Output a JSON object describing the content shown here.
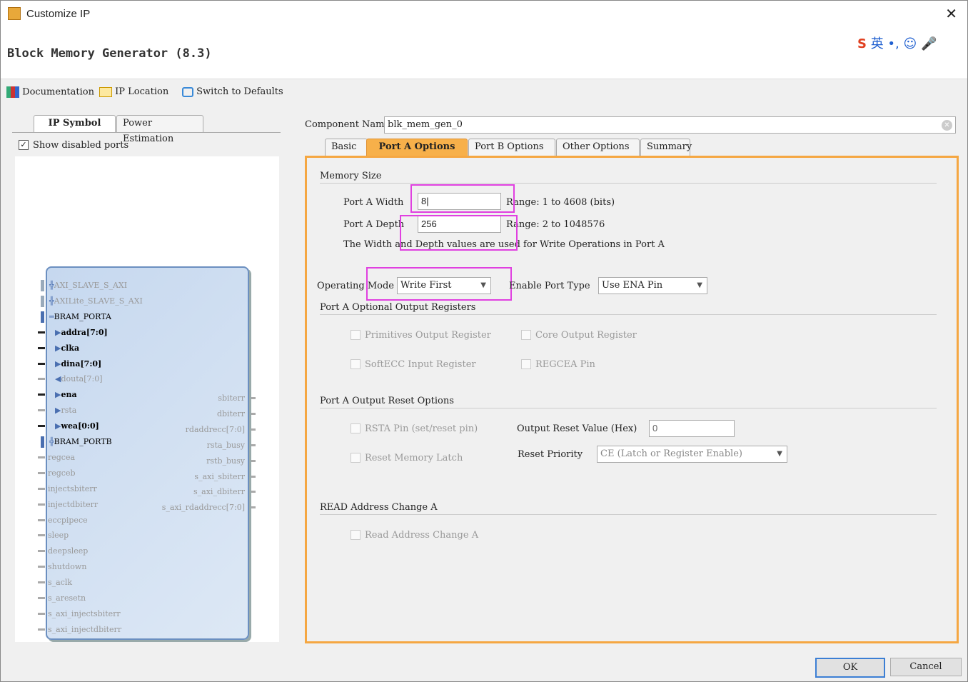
{
  "window": {
    "title": "Customize IP",
    "close_icon": "close-icon"
  },
  "header": {
    "title": "Block Memory Generator (8.3)"
  },
  "toolbar": {
    "documentation": "Documentation",
    "ip_location": "IP Location",
    "switch_defaults": "Switch to Defaults"
  },
  "left": {
    "tabs": [
      "IP Symbol",
      "Power Estimation"
    ],
    "show_disabled": "Show disabled ports",
    "show_disabled_checked": true,
    "left_ports": [
      {
        "name": "AXI_SLAVE_S_AXI",
        "enabled": false,
        "bus": true
      },
      {
        "name": "AXILite_SLAVE_S_AXI",
        "enabled": false,
        "bus": true
      },
      {
        "name": "BRAM_PORTA",
        "enabled": true,
        "bus": true
      },
      {
        "name": "addra[7:0]",
        "enabled": true
      },
      {
        "name": "clka",
        "enabled": true
      },
      {
        "name": "dina[7:0]",
        "enabled": true
      },
      {
        "name": "douta[7:0]",
        "enabled": false
      },
      {
        "name": "ena",
        "enabled": true
      },
      {
        "name": "rsta",
        "enabled": false
      },
      {
        "name": "wea[0:0]",
        "enabled": true
      },
      {
        "name": "BRAM_PORTB",
        "enabled": true,
        "bus": true
      },
      {
        "name": "regcea",
        "enabled": false
      },
      {
        "name": "regceb",
        "enabled": false
      },
      {
        "name": "injectsbiterr",
        "enabled": false
      },
      {
        "name": "injectdbiterr",
        "enabled": false
      },
      {
        "name": "eccpipece",
        "enabled": false
      },
      {
        "name": "sleep",
        "enabled": false
      },
      {
        "name": "deepsleep",
        "enabled": false
      },
      {
        "name": "shutdown",
        "enabled": false
      },
      {
        "name": "s_aclk",
        "enabled": false
      },
      {
        "name": "s_aresetn",
        "enabled": false
      },
      {
        "name": "s_axi_injectsbiterr",
        "enabled": false
      },
      {
        "name": "s_axi_injectdbiterr",
        "enabled": false
      }
    ],
    "right_ports": [
      "sbiterr",
      "dbiterr",
      "rdaddrecc[7:0]",
      "rsta_busy",
      "rstb_busy",
      "s_axi_sbiterr",
      "s_axi_dbiterr",
      "s_axi_rdaddrecc[7:0]"
    ]
  },
  "main": {
    "component_name_label": "Component Name",
    "component_name": "blk_mem_gen_0",
    "tabs": [
      "Basic",
      "Port A Options",
      "Port B Options",
      "Other Options",
      "Summary"
    ],
    "active_tab": "Port A Options",
    "memory_size": {
      "title": "Memory Size",
      "width_label": "Port A Width",
      "width": "8",
      "width_range": "Range: 1 to 4608 (bits)",
      "depth_label": "Port A Depth",
      "depth": "256",
      "depth_range": "Range: 2 to 1048576",
      "note": "The Width and Depth values are used for Write Operations in Port A"
    },
    "operating_mode_label": "Operating Mode",
    "operating_mode": "Write First",
    "enable_port_type_label": "Enable Port Type",
    "enable_port_type": "Use ENA Pin",
    "optional_regs": {
      "title": "Port A Optional Output Registers",
      "primitives": "Primitives Output Register",
      "core": "Core Output Register",
      "softecc": "SoftECC Input Register",
      "regcea": "REGCEA Pin"
    },
    "reset": {
      "title": "Port A Output Reset Options",
      "rsta": "RSTA Pin (set/reset pin)",
      "reset_value_label": "Output Reset Value (Hex)",
      "reset_value": "0",
      "latch": "Reset Memory Latch",
      "priority_label": "Reset Priority",
      "priority": "CE (Latch or Register Enable)"
    },
    "read_addr": {
      "title": "READ Address Change A",
      "option": "Read Address Change A"
    }
  },
  "footer": {
    "ok": "OK",
    "cancel": "Cancel"
  },
  "colors": {
    "accent": "#f5a742",
    "highlight": "#e040e0",
    "symbol_fill": "#c9d9ee"
  }
}
